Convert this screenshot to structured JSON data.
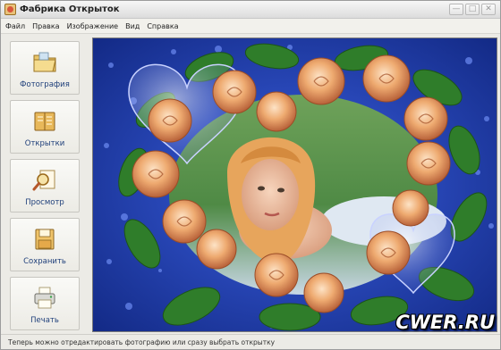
{
  "window": {
    "title": "Фабрика Открыток",
    "controls": [
      "—",
      "□",
      "✕"
    ]
  },
  "menu": [
    "Файл",
    "Правка",
    "Изображение",
    "Вид",
    "Справка"
  ],
  "toolbar": {
    "items": [
      {
        "label": "Фотография",
        "icon": "folder-open-icon"
      },
      {
        "label": "Открытки",
        "icon": "postcard-book-icon"
      },
      {
        "label": "Просмотр",
        "icon": "magnifier-icon"
      },
      {
        "label": "Сохранить",
        "icon": "floppy-disk-icon"
      },
      {
        "label": "Печать",
        "icon": "printer-icon"
      }
    ]
  },
  "preview": {
    "description_colors": {
      "background": "#1a2f8f",
      "water_drops": "#3556d4",
      "leaves": "#2f7d2a",
      "roses": "#e9a065",
      "heart_glass": "#9aa7e6"
    }
  },
  "status": {
    "text": "Теперь можно отредактировать фотографию или сразу выбрать открытку"
  },
  "watermark": {
    "text": "CWER.RU"
  }
}
